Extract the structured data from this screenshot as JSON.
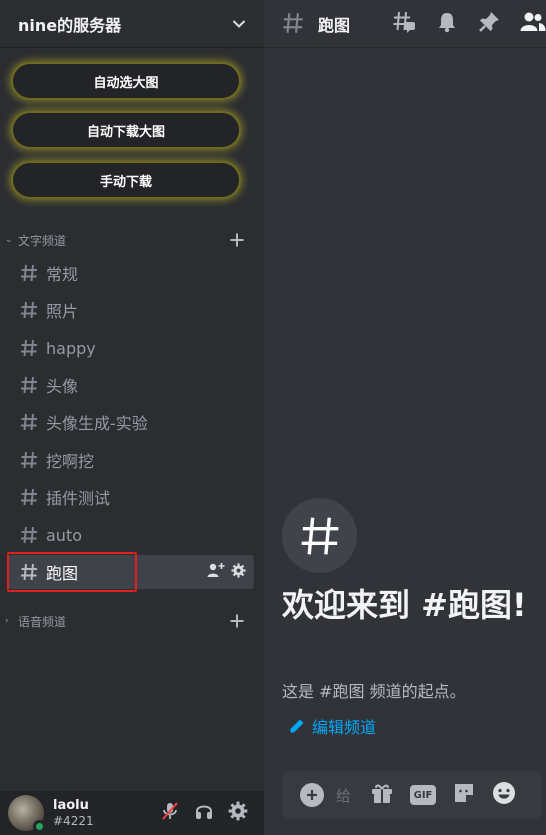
{
  "server": {
    "name": "nine的服务器"
  },
  "buttons": [
    {
      "label": "自动选大图"
    },
    {
      "label": "自动下载大图"
    },
    {
      "label": "手动下载"
    }
  ],
  "categories": {
    "text": {
      "label": "文字频道"
    },
    "voice": {
      "label": "语音频道"
    }
  },
  "channels": [
    {
      "name": "常规"
    },
    {
      "name": "照片"
    },
    {
      "name": "happy"
    },
    {
      "name": "头像"
    },
    {
      "name": "头像生成-实验"
    },
    {
      "name": "挖啊挖"
    },
    {
      "name": "插件测试"
    },
    {
      "name": "auto"
    },
    {
      "name": "跑图",
      "active": true
    }
  ],
  "topbar": {
    "title": "跑图"
  },
  "welcome": {
    "title": "欢迎来到 #跑图!",
    "subtitle": "这是 #跑图 频道的起点。",
    "edit_label": "编辑频道"
  },
  "composer": {
    "placeholder": "给"
  },
  "user": {
    "name": "laolu",
    "tag": "#4221",
    "status": "online"
  },
  "icons": {
    "server_menu": "chevron-down-icon",
    "threads": "threads-icon",
    "notifications": "bell-icon",
    "pinned": "pin-icon",
    "members": "members-icon",
    "gift": "gift-icon",
    "gif": "GIF",
    "sticker": "sticker-icon",
    "emoji": "emoji-icon"
  },
  "colors": {
    "accent_link": "#00a8fc",
    "online": "#23a55a",
    "highlight_box": "#e0201e",
    "button_glow": "#d2c828"
  }
}
